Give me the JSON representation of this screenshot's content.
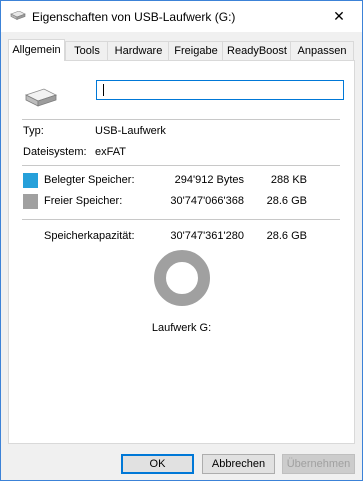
{
  "window": {
    "title": "Eigenschaften von USB-Laufwerk (G:)",
    "close_glyph": "✕"
  },
  "tabs": [
    {
      "label": "Allgemein",
      "active": true
    },
    {
      "label": "Tools"
    },
    {
      "label": "Hardware"
    },
    {
      "label": "Freigabe"
    },
    {
      "label": "ReadyBoost"
    },
    {
      "label": "Anpassen"
    }
  ],
  "name_field": {
    "value": ""
  },
  "info": {
    "type_label": "Typ:",
    "type_value": "USB-Laufwerk",
    "fs_label": "Dateisystem:",
    "fs_value": "exFAT"
  },
  "usage": {
    "used": {
      "label": "Belegter Speicher:",
      "bytes": "294'912 Bytes",
      "size": "288 KB",
      "color": "#26a0da"
    },
    "free": {
      "label": "Freier Speicher:",
      "bytes": "30'747'066'368",
      "size": "28.6 GB",
      "color": "#a0a0a0"
    },
    "capacity": {
      "label": "Speicherkapazität:",
      "bytes": "30'747'361'280",
      "size": "28.6 GB"
    },
    "used_fraction": 9.6e-06
  },
  "drive_label": "Laufwerk G:",
  "buttons": {
    "ok": "OK",
    "cancel": "Abbrechen",
    "apply": "Übernehmen"
  }
}
